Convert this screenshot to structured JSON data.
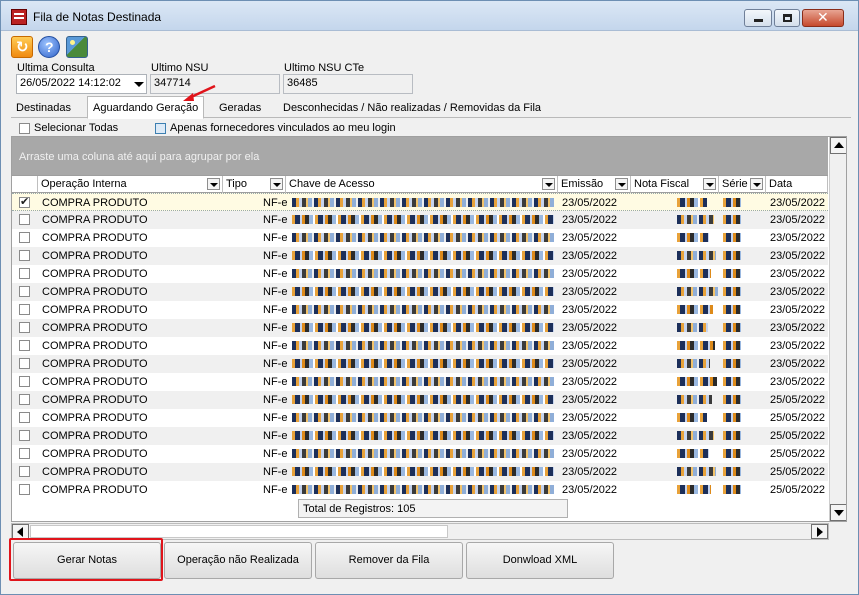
{
  "window": {
    "title": "Fila de Notas Destinada"
  },
  "filters": {
    "ultima_consulta_label": "Ultima Consulta",
    "ultima_consulta_value": "26/05/2022 14:12:02",
    "ultimo_nsu_label": "Ultimo NSU",
    "ultimo_nsu_value": "347714",
    "ultimo_nsu_cte_label": "Ultimo NSU CTe",
    "ultimo_nsu_cte_value": "36485"
  },
  "tabs": [
    {
      "label": "Destinadas"
    },
    {
      "label": "Aguardando Geração"
    },
    {
      "label": "Geradas"
    },
    {
      "label": "Desconhecidas / Não realizadas / Removidas da Fila"
    }
  ],
  "options": {
    "select_all_label": "Selecionar Todas",
    "linked_suppliers_label": "Apenas fornecedores vinculados ao meu login"
  },
  "grid": {
    "group_hint": "Arraste uma coluna até aqui para agrupar por ela",
    "columns": [
      "Operação Interna",
      "Tipo",
      "Chave de Acesso",
      "Emissão",
      "Nota Fiscal",
      "Série",
      "Data"
    ],
    "rows": [
      {
        "checked": true,
        "operacao": "COMPRA PRODUTO",
        "tipo": "NF-e",
        "emissao": "23/05/2022",
        "data": "23/05/2022"
      },
      {
        "checked": false,
        "operacao": "COMPRA PRODUTO",
        "tipo": "NF-e",
        "emissao": "23/05/2022",
        "data": "23/05/2022"
      },
      {
        "checked": false,
        "operacao": "COMPRA PRODUTO",
        "tipo": "NF-e",
        "emissao": "23/05/2022",
        "data": "23/05/2022"
      },
      {
        "checked": false,
        "operacao": "COMPRA PRODUTO",
        "tipo": "NF-e",
        "emissao": "23/05/2022",
        "data": "23/05/2022"
      },
      {
        "checked": false,
        "operacao": "COMPRA PRODUTO",
        "tipo": "NF-e",
        "emissao": "23/05/2022",
        "data": "23/05/2022"
      },
      {
        "checked": false,
        "operacao": "COMPRA PRODUTO",
        "tipo": "NF-e",
        "emissao": "23/05/2022",
        "data": "23/05/2022"
      },
      {
        "checked": false,
        "operacao": "COMPRA PRODUTO",
        "tipo": "NF-e",
        "emissao": "23/05/2022",
        "data": "23/05/2022"
      },
      {
        "checked": false,
        "operacao": "COMPRA PRODUTO",
        "tipo": "NF-e",
        "emissao": "23/05/2022",
        "data": "23/05/2022"
      },
      {
        "checked": false,
        "operacao": "COMPRA PRODUTO",
        "tipo": "NF-e",
        "emissao": "23/05/2022",
        "data": "23/05/2022"
      },
      {
        "checked": false,
        "operacao": "COMPRA PRODUTO",
        "tipo": "NF-e",
        "emissao": "23/05/2022",
        "data": "23/05/2022"
      },
      {
        "checked": false,
        "operacao": "COMPRA PRODUTO",
        "tipo": "NF-e",
        "emissao": "23/05/2022",
        "data": "23/05/2022"
      },
      {
        "checked": false,
        "operacao": "COMPRA PRODUTO",
        "tipo": "NF-e",
        "emissao": "23/05/2022",
        "data": "25/05/2022"
      },
      {
        "checked": false,
        "operacao": "COMPRA PRODUTO",
        "tipo": "NF-e",
        "emissao": "23/05/2022",
        "data": "25/05/2022"
      },
      {
        "checked": false,
        "operacao": "COMPRA PRODUTO",
        "tipo": "NF-e",
        "emissao": "23/05/2022",
        "data": "25/05/2022"
      },
      {
        "checked": false,
        "operacao": "COMPRA PRODUTO",
        "tipo": "NF-e",
        "emissao": "23/05/2022",
        "data": "25/05/2022"
      },
      {
        "checked": false,
        "operacao": "COMPRA PRODUTO",
        "tipo": "NF-e",
        "emissao": "23/05/2022",
        "data": "25/05/2022"
      },
      {
        "checked": false,
        "operacao": "COMPRA PRODUTO",
        "tipo": "NF-e",
        "emissao": "23/05/2022",
        "data": "25/05/2022"
      }
    ],
    "total_label": "Total de Registros: 105"
  },
  "actions": {
    "gerar": "Gerar Notas",
    "nao_realizada": "Operação não Realizada",
    "remover": "Remover da Fila",
    "download": "Donwload XML"
  },
  "colors": {
    "highlight": "#e0141b",
    "group_area": "#a8a8a8"
  }
}
